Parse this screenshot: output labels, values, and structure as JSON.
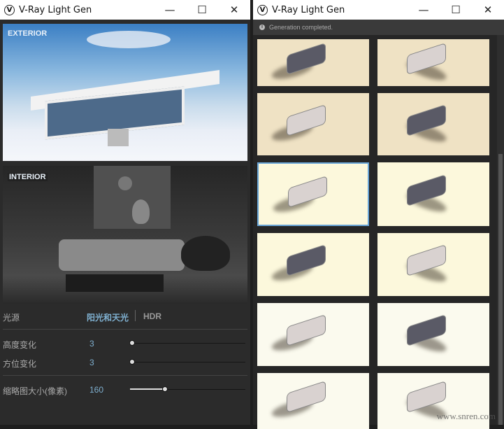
{
  "left_window": {
    "title": "V-Ray Light Gen",
    "minimize": "—",
    "maximize": "☐",
    "close": "✕",
    "exterior_label": "EXTERIOR",
    "interior_label": "INTERIOR",
    "light_source_label": "光源",
    "light_options": [
      "阳光和天光",
      "HDR"
    ],
    "light_selected": "阳光和天光",
    "height_variation_label": "高度变化",
    "height_variation_value": "3",
    "azimuth_variation_label": "方位变化",
    "azimuth_variation_value": "3",
    "thumb_size_label": "缩略图大小(像素)",
    "thumb_size_value": "160",
    "thumb_size_fraction": 0.3
  },
  "right_window": {
    "title": "V-Ray Light Gen",
    "minimize": "—",
    "maximize": "☐",
    "close": "✕",
    "status_icon": "info-icon",
    "status": "Generation completed.",
    "watermark": "www.snren.com"
  },
  "colors": {
    "accent": "#7fb0d0",
    "selected_border": "#6aa6d8"
  }
}
